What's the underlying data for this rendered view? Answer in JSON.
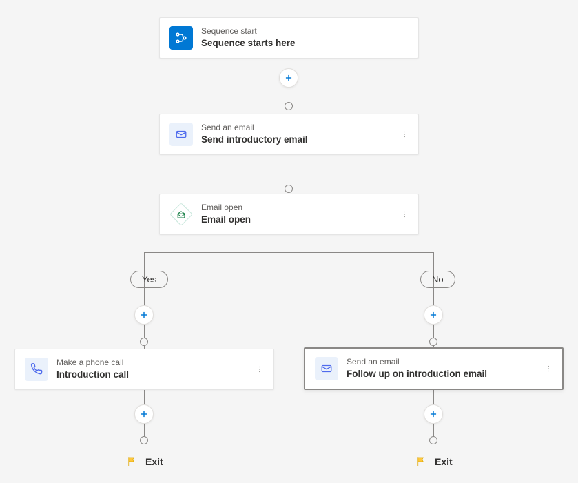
{
  "nodes": {
    "start": {
      "type": "Sequence start",
      "title": "Sequence starts here"
    },
    "email1": {
      "type": "Send an email",
      "title": "Send introductory email"
    },
    "cond": {
      "type": "Email open",
      "title": "Email open"
    },
    "phone": {
      "type": "Make a phone call",
      "title": "Introduction call"
    },
    "email2": {
      "type": "Send an email",
      "title": "Follow up on introduction email"
    }
  },
  "branches": {
    "yes": "Yes",
    "no": "No"
  },
  "exit": {
    "label": "Exit"
  }
}
